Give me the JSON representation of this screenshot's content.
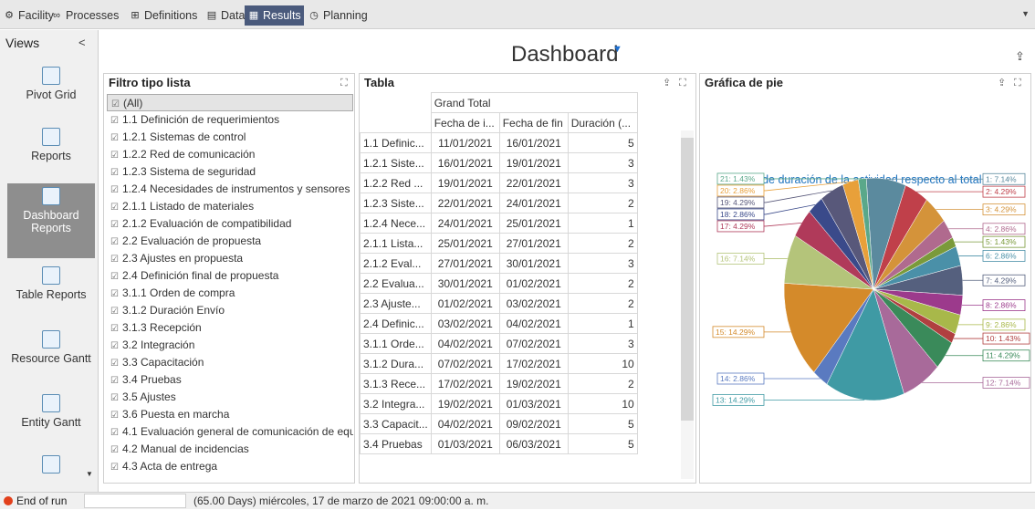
{
  "tabs": [
    {
      "label": "Facility",
      "icon": "facility-icon"
    },
    {
      "label": "Processes",
      "icon": "processes-icon"
    },
    {
      "label": "Definitions",
      "icon": "definitions-icon"
    },
    {
      "label": "Data",
      "icon": "data-icon"
    },
    {
      "label": "Results",
      "icon": "results-icon",
      "active": true
    },
    {
      "label": "Planning",
      "icon": "planning-icon"
    }
  ],
  "views": {
    "title": "Views",
    "collapse": "<",
    "items": [
      {
        "label": "Pivot Grid",
        "icon": "pivot-grid-icon"
      },
      {
        "label": "Reports",
        "icon": "reports-icon"
      },
      {
        "label": "Dashboard Reports",
        "icon": "dashboard-reports-icon",
        "active": true
      },
      {
        "label": "Table Reports",
        "icon": "table-reports-icon"
      },
      {
        "label": "Resource Gantt",
        "icon": "resource-gantt-icon"
      },
      {
        "label": "Entity Gantt",
        "icon": "entity-gantt-icon"
      },
      {
        "label": "",
        "icon": "more-report-icon"
      }
    ]
  },
  "dashboard": {
    "title": "Dashboard"
  },
  "filtro": {
    "title": "Filtro tipo lista",
    "items": [
      "(All)",
      "1.1 Definición de requerimientos",
      "1.2.1 Sistemas de control",
      "1.2.2 Red de comunicación",
      "1.2.3 Sistema de seguridad",
      "1.2.4 Necesidades de instrumentos y sensores",
      "2.1.1 Listado de materiales",
      "2.1.2 Evaluación de compatibilidad",
      "2.2 Evaluación de propuesta",
      "2.3 Ajustes en propuesta",
      "2.4 Definición final de propuesta",
      "3.1.1 Orden de compra",
      "3.1.2 Duración Envío",
      "3.1.3 Recepción",
      "3.2 Integración",
      "3.3 Capacitación",
      "3.4 Pruebas",
      "3.5 Ajustes",
      "3.6 Puesta en marcha",
      "4.1 Evaluación general de comunicación de equ",
      "4.2 Manual de incidencias",
      "4.3 Acta de entrega"
    ]
  },
  "tabla": {
    "title": "Tabla",
    "grand_total": "Grand Total",
    "columns": [
      "Fecha de i...",
      "Fecha de fin",
      "Duración (..."
    ],
    "rows": [
      {
        "label": "1.1 Definic...",
        "start": "11/01/2021",
        "end": "16/01/2021",
        "dur": "5"
      },
      {
        "label": "1.2.1 Siste...",
        "start": "16/01/2021",
        "end": "19/01/2021",
        "dur": "3"
      },
      {
        "label": "1.2.2 Red ...",
        "start": "19/01/2021",
        "end": "22/01/2021",
        "dur": "3"
      },
      {
        "label": "1.2.3 Siste...",
        "start": "22/01/2021",
        "end": "24/01/2021",
        "dur": "2"
      },
      {
        "label": "1.2.4 Nece...",
        "start": "24/01/2021",
        "end": "25/01/2021",
        "dur": "1"
      },
      {
        "label": "2.1.1 Lista...",
        "start": "25/01/2021",
        "end": "27/01/2021",
        "dur": "2"
      },
      {
        "label": "2.1.2 Eval...",
        "start": "27/01/2021",
        "end": "30/01/2021",
        "dur": "3"
      },
      {
        "label": "2.2 Evalua...",
        "start": "30/01/2021",
        "end": "01/02/2021",
        "dur": "2"
      },
      {
        "label": "2.3 Ajuste...",
        "start": "01/02/2021",
        "end": "03/02/2021",
        "dur": "2"
      },
      {
        "label": "2.4 Definic...",
        "start": "03/02/2021",
        "end": "04/02/2021",
        "dur": "1"
      },
      {
        "label": "3.1.1 Orde...",
        "start": "04/02/2021",
        "end": "07/02/2021",
        "dur": "3"
      },
      {
        "label": "3.1.2 Dura...",
        "start": "07/02/2021",
        "end": "17/02/2021",
        "dur": "10"
      },
      {
        "label": "3.1.3 Rece...",
        "start": "17/02/2021",
        "end": "19/02/2021",
        "dur": "2"
      },
      {
        "label": "3.2 Integra...",
        "start": "19/02/2021",
        "end": "01/03/2021",
        "dur": "10"
      },
      {
        "label": "3.3 Capacit...",
        "start": "04/02/2021",
        "end": "09/02/2021",
        "dur": "5"
      },
      {
        "label": "3.4 Pruebas",
        "start": "01/03/2021",
        "end": "06/03/2021",
        "dur": "5"
      }
    ]
  },
  "pie_panel": {
    "title": "Gráfica de pie"
  },
  "chart_data": {
    "type": "pie",
    "title": "% de duración de la actividad respecto al total",
    "slices": [
      {
        "label": "1: 7.14%",
        "value": 7.14,
        "color": "#5b8a9e"
      },
      {
        "label": "2: 4.29%",
        "value": 4.29,
        "color": "#c0404a"
      },
      {
        "label": "3: 4.29%",
        "value": 4.29,
        "color": "#d4933a"
      },
      {
        "label": "4: 2.86%",
        "value": 2.86,
        "color": "#b06a8e"
      },
      {
        "label": "5: 1.43%",
        "value": 1.43,
        "color": "#7a9a3a"
      },
      {
        "label": "6: 2.86%",
        "value": 2.86,
        "color": "#4a90a8"
      },
      {
        "label": "7: 4.29%",
        "value": 4.29,
        "color": "#55607e"
      },
      {
        "label": "8: 2.86%",
        "value": 2.86,
        "color": "#9c3a8c"
      },
      {
        "label": "9: 2.86%",
        "value": 2.86,
        "color": "#a8b84a"
      },
      {
        "label": "10: 1.43%",
        "value": 1.43,
        "color": "#b04040"
      },
      {
        "label": "11: 4.29%",
        "value": 4.29,
        "color": "#3a8a5a"
      },
      {
        "label": "12: 7.14%",
        "value": 7.14,
        "color": "#a86a9a"
      },
      {
        "label": "13: 14.29%",
        "value": 14.29,
        "color": "#3f9aa4"
      },
      {
        "label": "14: 2.86%",
        "value": 2.86,
        "color": "#5a7ac0"
      },
      {
        "label": "15: 14.29%",
        "value": 14.29,
        "color": "#d48a2a"
      },
      {
        "label": "16: 7.14%",
        "value": 7.14,
        "color": "#b4c47a"
      },
      {
        "label": "17: 4.29%",
        "value": 4.29,
        "color": "#b03a5a"
      },
      {
        "label": "18: 2.86%",
        "value": 2.86,
        "color": "#3a4a8a"
      },
      {
        "label": "19: 4.29%",
        "value": 4.29,
        "color": "#58587a"
      },
      {
        "label": "20: 2.86%",
        "value": 2.86,
        "color": "#e8a03a"
      },
      {
        "label": "21: 1.43%",
        "value": 1.43,
        "color": "#5aa88a"
      }
    ]
  },
  "status": {
    "label": "End of run",
    "text": "(65.00 Days) miércoles, 17 de marzo de 2021 09:00:00 a. m."
  }
}
